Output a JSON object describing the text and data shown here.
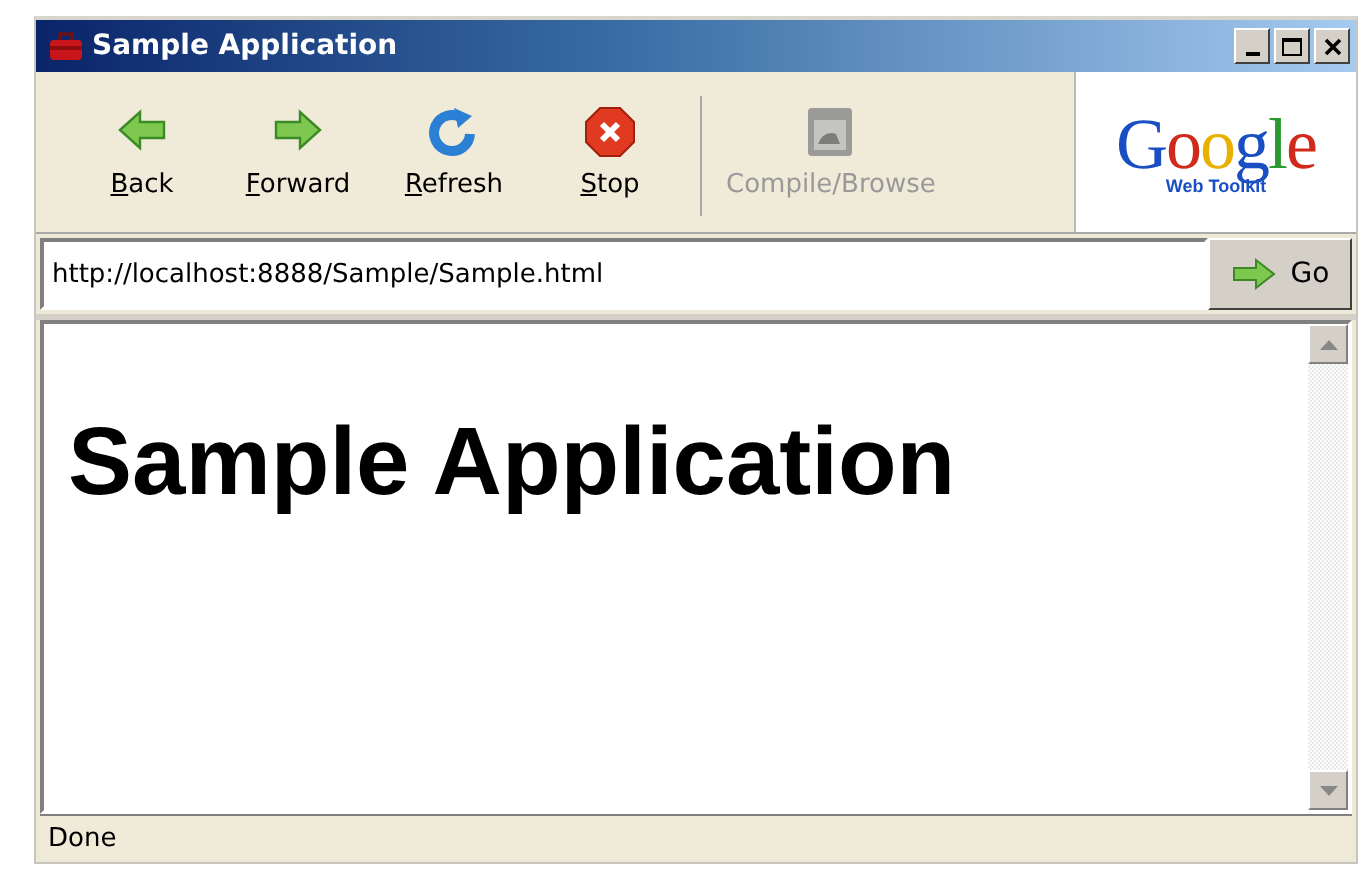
{
  "window": {
    "title": "Sample Application",
    "controls": [
      {
        "kind": "minimize"
      },
      {
        "kind": "maximize"
      },
      {
        "kind": "close"
      }
    ]
  },
  "toolbar": {
    "buttons": [
      {
        "kind": "back",
        "label": "Back",
        "underline_first": true,
        "disabled": false
      },
      {
        "kind": "forward",
        "label": "Forward",
        "underline_first": true,
        "disabled": false
      },
      {
        "kind": "refresh",
        "label": "Refresh",
        "underline_first": true,
        "disabled": false
      },
      {
        "kind": "stop",
        "label": "Stop",
        "underline_first": true,
        "disabled": false
      },
      {
        "kind": "separator"
      },
      {
        "kind": "compile",
        "label": "Compile/Browse",
        "underline_first": false,
        "disabled": true
      }
    ],
    "logo": {
      "word": "Google",
      "caption": "Web Toolkit"
    }
  },
  "address_bar": {
    "value": "http://localhost:8888/Sample/Sample.html",
    "go_button": "Go"
  },
  "content": {
    "heading": "Sample Application"
  },
  "status_bar": {
    "text": "Done"
  }
}
